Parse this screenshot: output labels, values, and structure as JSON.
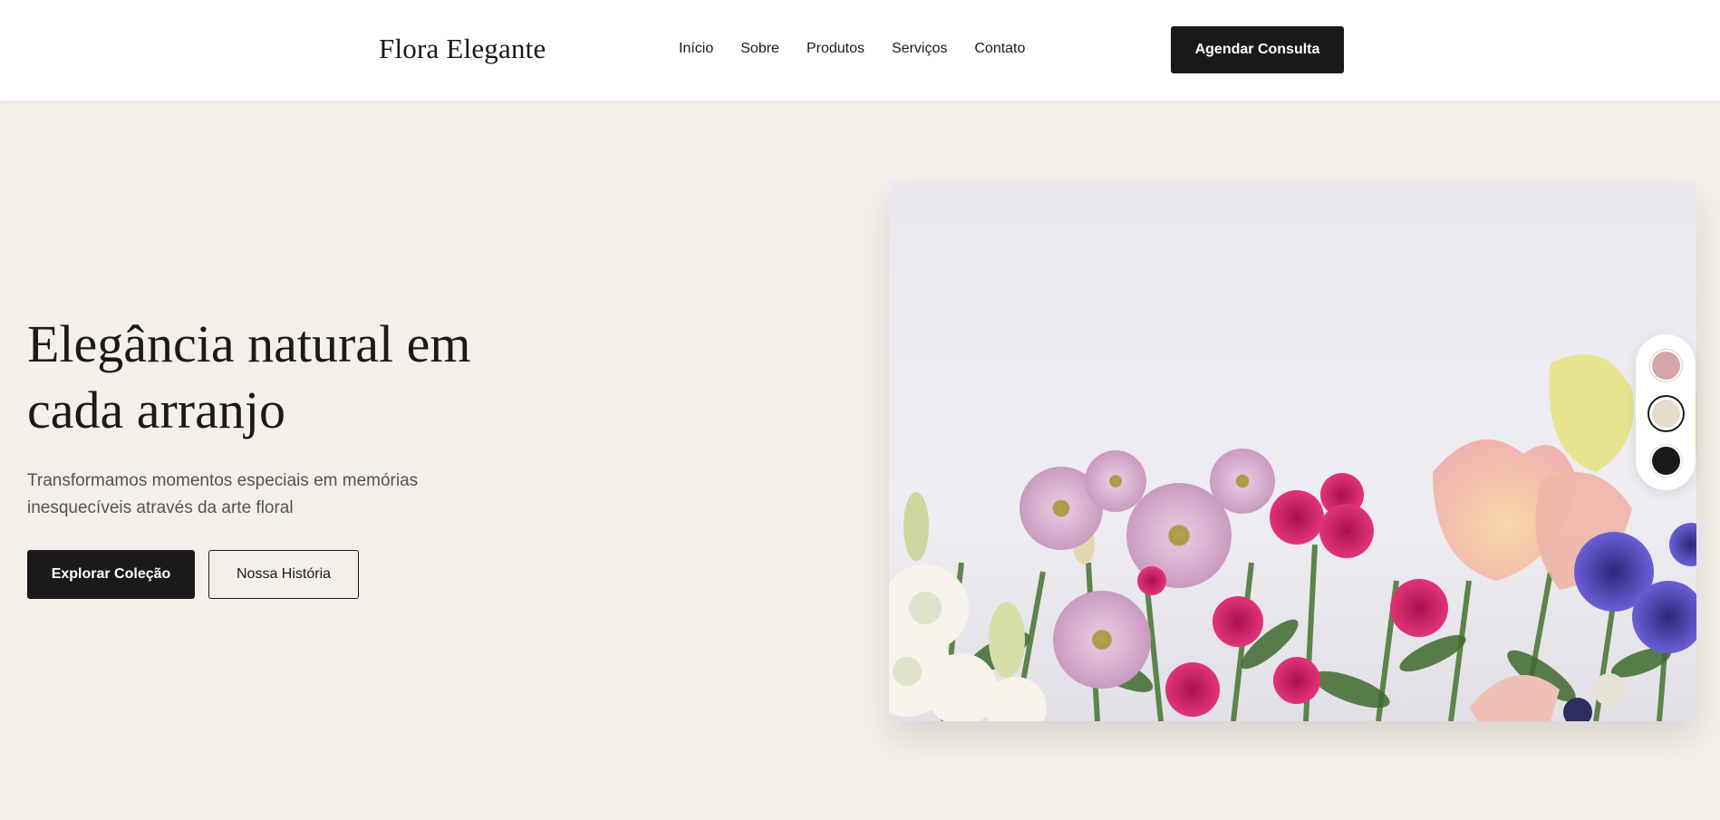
{
  "header": {
    "logo": "Flora Elegante",
    "nav": [
      "Início",
      "Sobre",
      "Produtos",
      "Serviços",
      "Contato"
    ],
    "cta_label": "Agendar Consulta"
  },
  "hero": {
    "title": "Elegância natural em cada arranjo",
    "subtitle": "Transformamos momentos especiais em memórias inesquecíveis através da arte floral",
    "primary_button": "Explorar Coleção",
    "secondary_button": "Nossa História",
    "image_icon": "flower-bouquet-photo"
  },
  "theme_swatches": [
    {
      "name": "rose",
      "color": "#d4a5a5",
      "selected": false
    },
    {
      "name": "beige",
      "color": "#e6dccb",
      "selected": true
    },
    {
      "name": "black",
      "color": "#1a1a1a",
      "selected": false
    }
  ],
  "colors": {
    "background": "#f4f0e9",
    "header_bg": "#ffffff",
    "accent_dark": "#1a1a1a",
    "text_muted": "#555350"
  }
}
